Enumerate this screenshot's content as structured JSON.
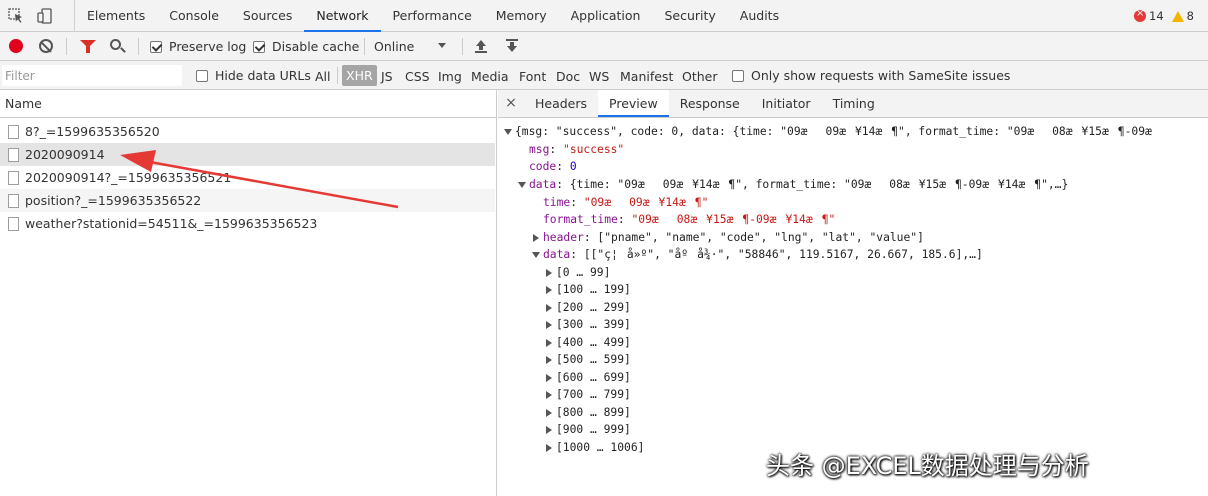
{
  "top": {
    "tabs": [
      "Elements",
      "Console",
      "Sources",
      "Network",
      "Performance",
      "Memory",
      "Application",
      "Security",
      "Audits"
    ],
    "active_tab": "Network",
    "error_count": "14",
    "warning_count": "8"
  },
  "toolbar": {
    "preserve_log": "Preserve log",
    "disable_cache": "Disable cache",
    "throttle": "Online"
  },
  "filterbar": {
    "placeholder": "Filter",
    "hide_data_urls": "Hide data URLs",
    "types": [
      "All",
      "XHR",
      "JS",
      "CSS",
      "Img",
      "Media",
      "Font",
      "Doc",
      "WS",
      "Manifest",
      "Other"
    ],
    "active_type": "XHR",
    "samesite": "Only show requests with SameSite issues"
  },
  "requests": {
    "header": "Name",
    "items": [
      "8?_=1599635356520",
      "2020090914",
      "2020090914?_=1599635356521",
      "position?_=1599635356522",
      "weather?stationid=54511&_=1599635356523"
    ]
  },
  "detail": {
    "close": "×",
    "tabs": [
      "Headers",
      "Preview",
      "Response",
      "Initiator",
      "Timing"
    ],
    "active_tab": "Preview",
    "root": "{msg: \"success\", code: 0, data: {time: \"09æ09æ¥14æ¶\", format_time: \"09æ08æ¥15æ¶-09æ",
    "msg_key": "msg",
    "msg_val": "\"success\"",
    "code_key": "code",
    "code_val": "0",
    "data_key": "data",
    "data_summary": "{time: \"09æ09æ¥14æ¶\", format_time: \"09æ08æ¥15æ¶-09æ¥14æ¶\",…}",
    "time_key": "time",
    "time_val": "\"09æ09æ¥14æ¶\"",
    "format_time_key": "format_time",
    "format_time_val": "\"09æ08æ¥15æ¶-09æ¥14æ¶\"",
    "header_key": "header",
    "header_val": "[\"pname\", \"name\", \"code\", \"lng\", \"lat\", \"value\"]",
    "data2_key": "data",
    "data2_val": "[[\"ç¦å»º\", \"åºå¾·\", \"58846\", 119.5167, 26.667, 185.6],…]",
    "ranges": [
      "[0 … 99]",
      "[100 … 199]",
      "[200 … 299]",
      "[300 … 399]",
      "[400 … 499]",
      "[500 … 599]",
      "[600 … 699]",
      "[700 … 799]",
      "[800 … 899]",
      "[900 … 999]",
      "[1000 … 1006]"
    ]
  },
  "watermark": "头条 @EXCEL数据处理与分析"
}
